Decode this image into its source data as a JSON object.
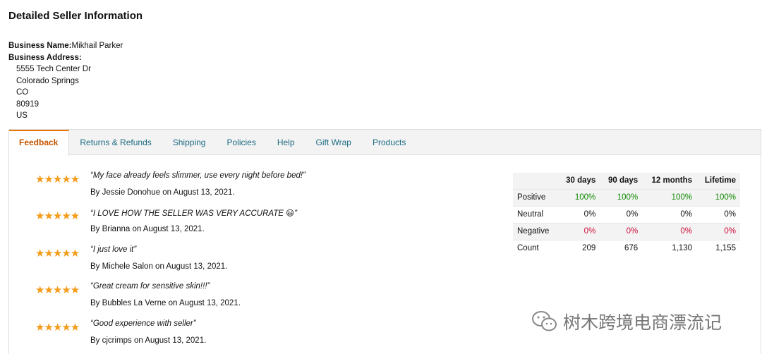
{
  "page": {
    "title": "Detailed Seller Information"
  },
  "business": {
    "name_label": "Business Name:",
    "name": "Mikhail Parker",
    "address_label": "Business Address:",
    "address": [
      "5555 Tech Center Dr",
      "Colorado Springs",
      "CO",
      "80919",
      "US"
    ]
  },
  "tabs": [
    "Feedback",
    "Returns & Refunds",
    "Shipping",
    "Policies",
    "Help",
    "Gift Wrap",
    "Products"
  ],
  "reviews": [
    {
      "stars": 5,
      "quote": "“My face already feels slimmer, use every night before bed!”",
      "byline": "By Jessie Donohue on August 13, 2021."
    },
    {
      "stars": 5,
      "quote": "“I LOVE HOW THE SELLER WAS VERY ACCURATE 😃”",
      "byline": "By Brianna on August 13, 2021."
    },
    {
      "stars": 5,
      "quote": "“I just love it”",
      "byline": "By Michele Salon on August 13, 2021."
    },
    {
      "stars": 5,
      "quote": "“Great cream for sensitive skin!!!”",
      "byline": "By Bubbles La Verne on August 13, 2021."
    },
    {
      "stars": 5,
      "quote": "“Good experience with seller”",
      "byline": "By cjcrimps on August 13, 2021."
    }
  ],
  "feedback_table": {
    "headers": [
      "",
      "30 days",
      "90 days",
      "12 months",
      "Lifetime"
    ],
    "rows": [
      {
        "label": "Positive",
        "values": [
          "100%",
          "100%",
          "100%",
          "100%"
        ],
        "color": "#108a00"
      },
      {
        "label": "Neutral",
        "values": [
          "0%",
          "0%",
          "0%",
          "0%"
        ],
        "color": "#111111"
      },
      {
        "label": "Negative",
        "values": [
          "0%",
          "0%",
          "0%",
          "0%"
        ],
        "color": "#cc0c39"
      },
      {
        "label": "Count",
        "values": [
          "209",
          "676",
          "1,130",
          "1,155"
        ],
        "color": "#111111"
      }
    ]
  },
  "watermark": {
    "text": "树木跨境电商漂流记",
    "icon": "wechat-icon"
  },
  "colors": {
    "star": "#f59b1a",
    "active_tab": "#c45500",
    "tab_link": "#1b6a82",
    "positive": "#108a00",
    "negative": "#cc0c39"
  }
}
